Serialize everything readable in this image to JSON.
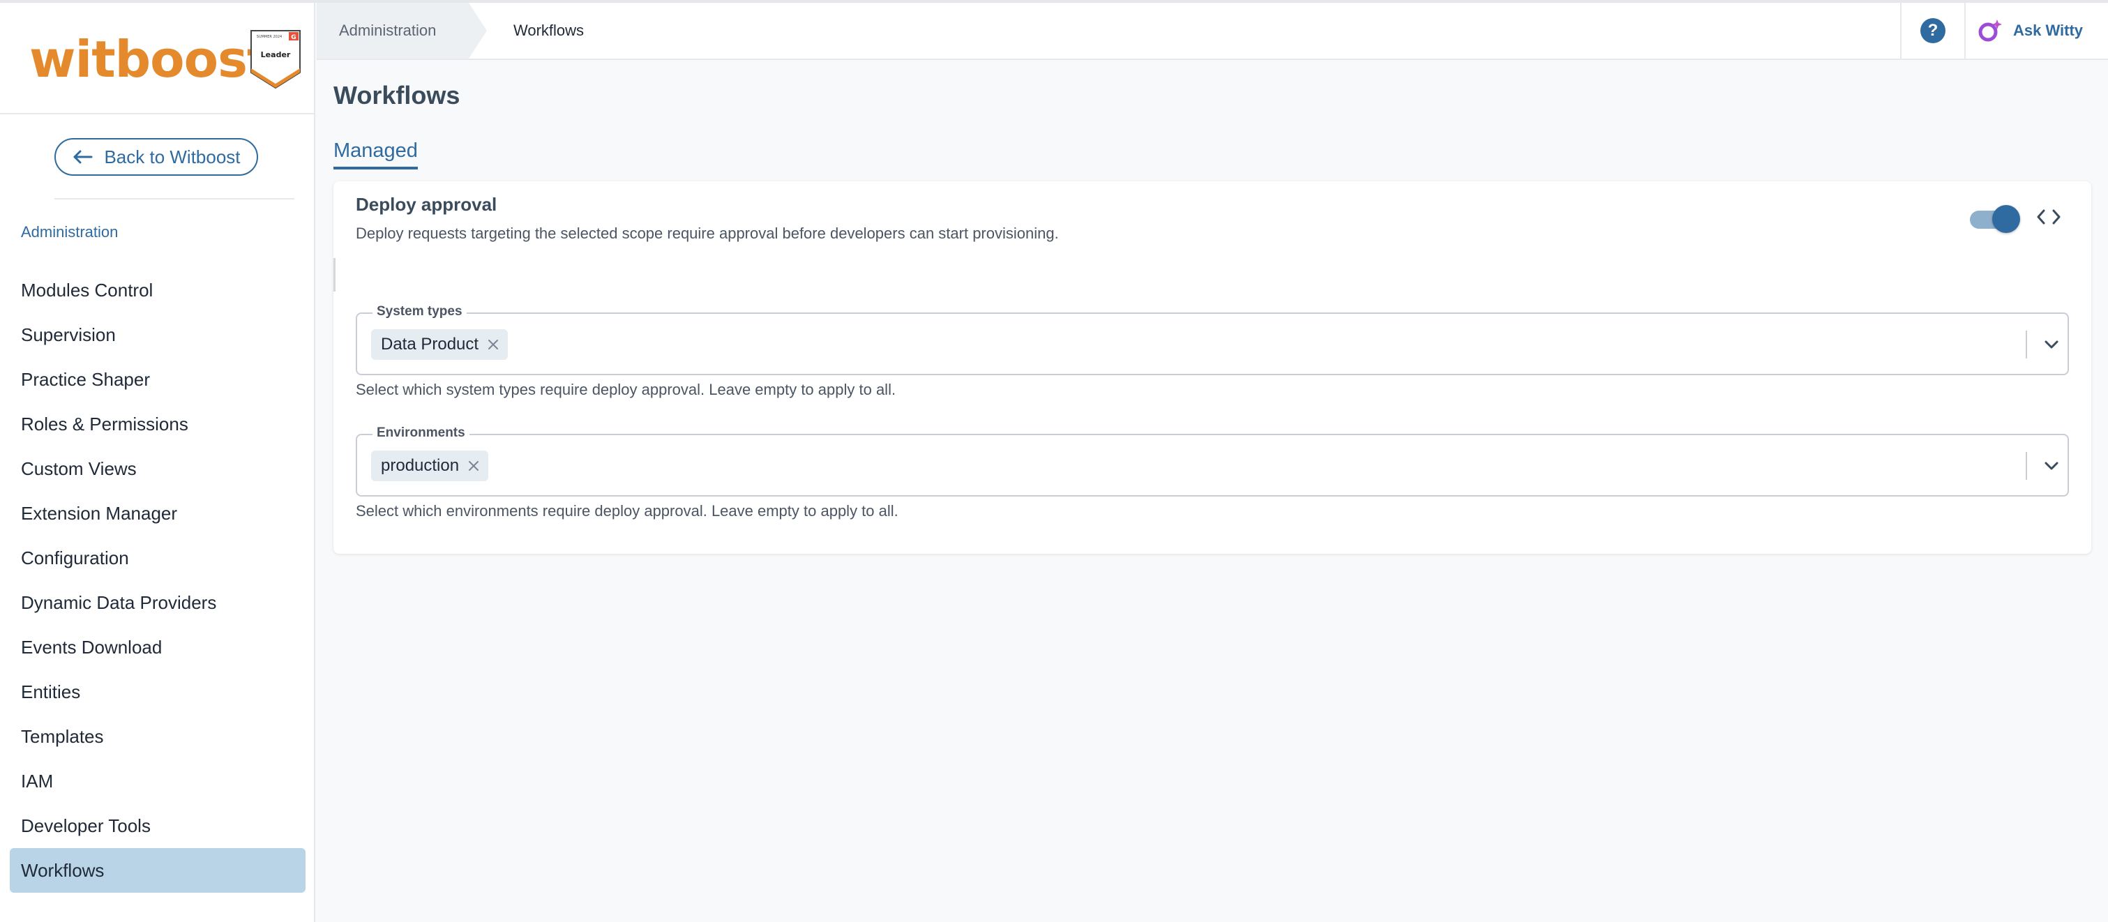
{
  "brand": {
    "wordmark": "witboost",
    "badge_top": "SUMMER 2024",
    "badge_label": "Leader",
    "badge_g": "G",
    "accent_orange": "#e58a2c",
    "accent_blue": "#2f6aa0"
  },
  "sidebar": {
    "back_label": "Back to Witboost",
    "section_label": "Administration",
    "items": [
      {
        "label": "Modules Control"
      },
      {
        "label": "Supervision"
      },
      {
        "label": "Practice Shaper"
      },
      {
        "label": "Roles & Permissions"
      },
      {
        "label": "Custom Views"
      },
      {
        "label": "Extension Manager"
      },
      {
        "label": "Configuration"
      },
      {
        "label": "Dynamic Data Providers"
      },
      {
        "label": "Events Download"
      },
      {
        "label": "Entities"
      },
      {
        "label": "Templates"
      },
      {
        "label": "IAM"
      },
      {
        "label": "Developer Tools"
      },
      {
        "label": "Workflows"
      }
    ],
    "active_item": "Workflows"
  },
  "topbar": {
    "breadcrumb": [
      "Administration",
      "Workflows"
    ],
    "help_icon": "help-circle-icon",
    "help_glyph": "?",
    "assistant_label": "Ask Witty"
  },
  "main": {
    "title": "Workflows",
    "tabs": [
      {
        "label": "Managed"
      }
    ],
    "card": {
      "title": "Deploy approval",
      "description": "Deploy requests targeting the selected scope require approval before developers can start provisioning.",
      "enabled": true,
      "fields": [
        {
          "label": "System types",
          "chips": [
            "Data Product"
          ],
          "helper": "Select which system types require deploy approval. Leave empty to apply to all."
        },
        {
          "label": "Environments",
          "chips": [
            "production"
          ],
          "helper": "Select which environments require deploy approval. Leave empty to apply to all."
        }
      ]
    }
  }
}
